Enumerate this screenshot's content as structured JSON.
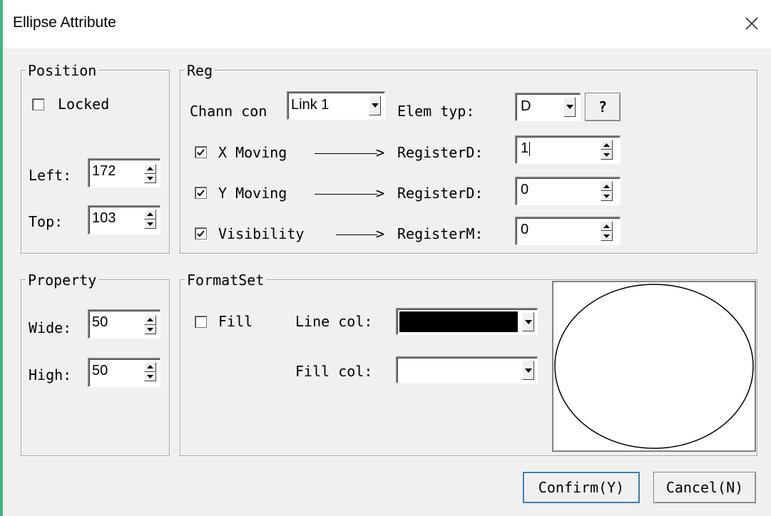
{
  "window": {
    "title": "Ellipse Attribute"
  },
  "position": {
    "label": "Position",
    "locked_label": "Locked",
    "locked_checked": false,
    "left_label": "Left:",
    "left_value": "172",
    "top_label": "Top:",
    "top_value": "103"
  },
  "reg": {
    "label": "Reg",
    "chann_label": "Chann con",
    "chann_value": "Link 1",
    "elem_label": "Elem typ:",
    "elem_value": "D",
    "help_label": "?",
    "rows": [
      {
        "label": "X Moving",
        "checked": true,
        "register_label": "RegisterD:",
        "value": "1"
      },
      {
        "label": "Y Moving",
        "checked": true,
        "register_label": "RegisterD:",
        "value": "0"
      },
      {
        "label": "Visibility",
        "checked": true,
        "register_label": "RegisterM:",
        "value": "0"
      }
    ]
  },
  "property": {
    "label": "Property",
    "wide_label": "Wide:",
    "wide_value": "50",
    "high_label": "High:",
    "high_value": "50"
  },
  "formatset": {
    "label": "FormatSet",
    "fill_label": "Fill",
    "fill_checked": false,
    "line_col_label": "Line col:",
    "line_col_value": "#000000",
    "fill_col_label": "Fill col:",
    "fill_col_value": "#ffffff"
  },
  "buttons": {
    "confirm": "Confirm(Y)",
    "cancel": "Cancel(N)"
  },
  "icons": {
    "close": "close-icon",
    "spin_up": "spin-up-icon",
    "spin_down": "spin-down-icon",
    "dropdown": "chevron-down-icon",
    "check": "checkmark-icon"
  }
}
